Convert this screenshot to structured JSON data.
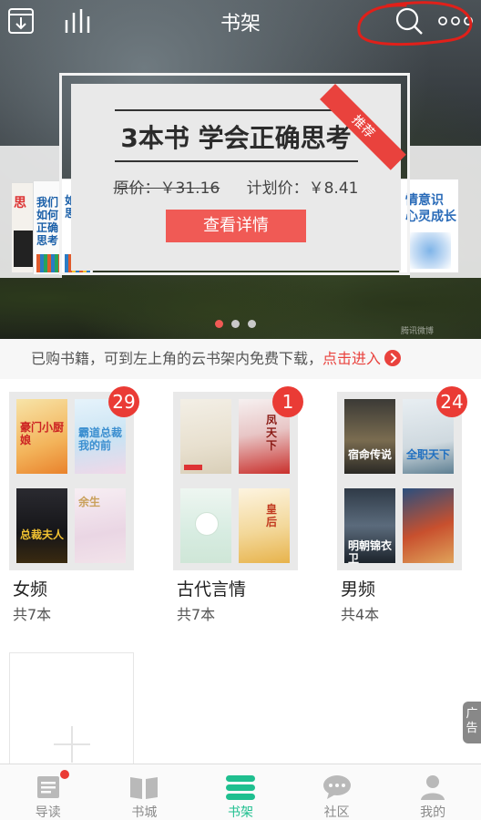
{
  "header": {
    "title": "书架"
  },
  "banner": {
    "ribbon": "推荐",
    "headline": "3本书 学会正确思考",
    "original_price": "原价：￥31.16",
    "plan_price": "计划价：￥8.41",
    "button": "查看详情",
    "left_books": [
      "思",
      "我们如何正确思考",
      "如何思考"
    ],
    "right_book": "情意识 心灵成长",
    "watermark": "腾讯微博",
    "carousel": {
      "count": 3,
      "active_index": 0
    }
  },
  "notice": {
    "text": "已购书籍，可到左上角的云书架内免费下载，",
    "link": "点击进入"
  },
  "groups": [
    {
      "name": "女频",
      "count": "共7本",
      "badge": "29",
      "covers": [
        "豪门小厨娘",
        "霸道总裁我的前",
        "总裁夫人",
        "余生"
      ]
    },
    {
      "name": "古代言情",
      "count": "共7本",
      "badge": "1",
      "covers": [
        "",
        "凤天下",
        "",
        "皇后"
      ]
    },
    {
      "name": "男频",
      "count": "共4本",
      "badge": "24",
      "covers": [
        "宿命传说",
        "全职天下",
        "明朝锦衣卫",
        ""
      ]
    }
  ],
  "ad_tab": "广告",
  "tabbar": [
    {
      "label": "导读",
      "icon": "guide-icon"
    },
    {
      "label": "书城",
      "icon": "bookstore-icon"
    },
    {
      "label": "书架",
      "icon": "bookshelf-icon",
      "active": true
    },
    {
      "label": "社区",
      "icon": "community-icon"
    },
    {
      "label": "我的",
      "icon": "profile-icon"
    }
  ],
  "colors": {
    "accent": "#1fbf8f",
    "red": "#ea3b35",
    "promo_button": "#f05a55"
  }
}
